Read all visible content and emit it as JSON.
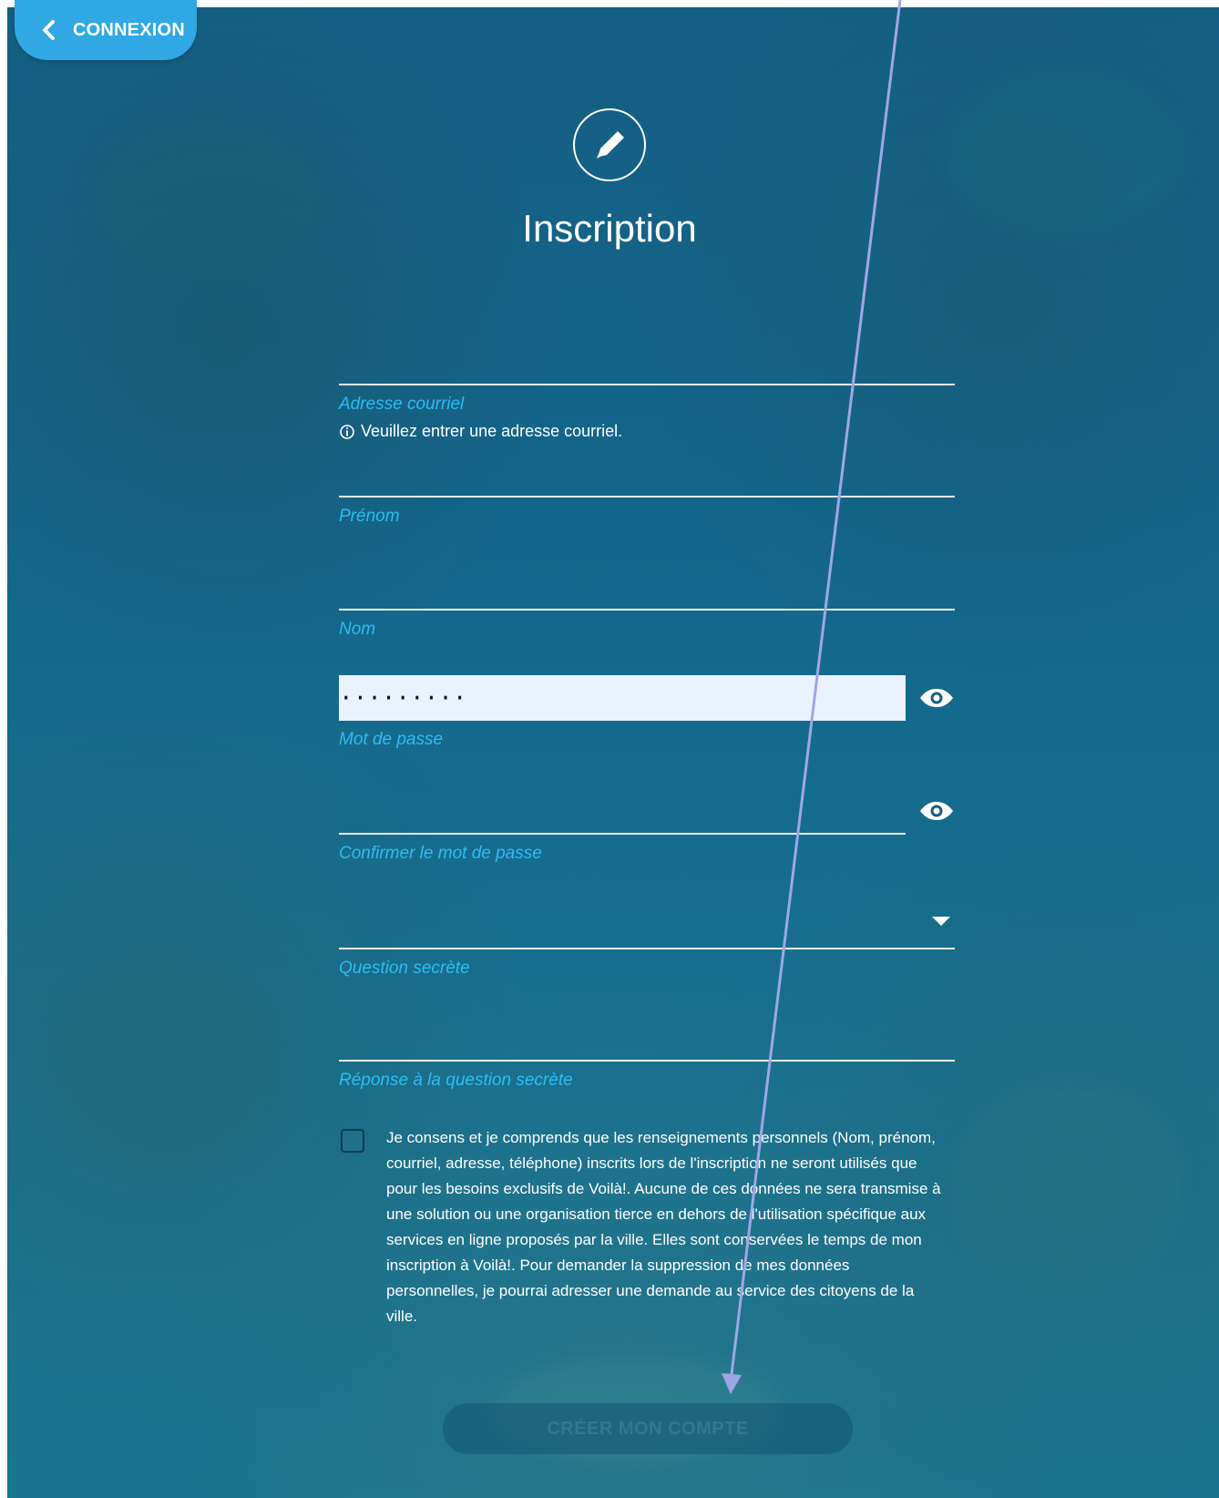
{
  "header": {
    "back_label": "CONNEXION",
    "title": "Inscription"
  },
  "form": {
    "email": {
      "label": "Adresse courriel",
      "help": "Veuillez entrer une adresse courriel."
    },
    "first_name": {
      "label": "Prénom"
    },
    "last_name": {
      "label": "Nom"
    },
    "password": {
      "label": "Mot de passe",
      "value": "·········"
    },
    "password_confirm": {
      "label": "Confirmer le mot de passe"
    },
    "secret_question": {
      "label": "Question secrète"
    },
    "secret_answer": {
      "label": "Réponse à la question secrète"
    }
  },
  "consent": {
    "text": "Je consens et je comprends que les renseignements personnels (Nom, prénom, courriel, adresse, téléphone) inscrits lors de l'inscription ne seront utilisés que pour les besoins exclusifs de Voilà!. Aucune de ces données ne sera transmise à une solution ou une organisation tierce en dehors de l'utilisation spécifique aux services en ligne proposés par la ville. Elles sont conservées le temps de mon inscription à Voilà!. Pour demander la suppression de mes données personnelles, je pourrai adresser une demande au service des citoyens de la ville."
  },
  "actions": {
    "submit_label": "CRÉER MON COMPTE"
  },
  "colors": {
    "accent": "#2fa8e4",
    "label_blue": "#2dbdf3",
    "background": "#145f83",
    "annotation": "#9ea7e6"
  },
  "icons": {
    "back": "chevron-left-icon",
    "edit": "pencil-icon",
    "info": "info-icon",
    "visibility": "eye-icon",
    "dropdown": "chevron-down-icon",
    "checkbox": "checkbox-icon"
  }
}
